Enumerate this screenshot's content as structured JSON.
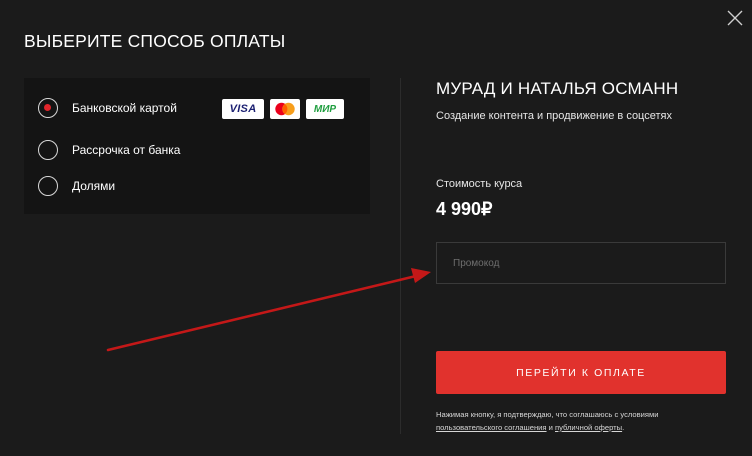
{
  "modal": {
    "title": "ВЫБЕРИТЕ СПОСОБ ОПЛАТЫ",
    "close_icon": "close-icon"
  },
  "payment_methods": [
    {
      "label": "Банковской картой",
      "selected": true
    },
    {
      "label": "Рассрочка от банка",
      "selected": false
    },
    {
      "label": "Долями",
      "selected": false
    }
  ],
  "card_logos": {
    "visa": "VISA",
    "mastercard": "mastercard-icon",
    "mir": "МИР"
  },
  "course": {
    "title": "МУРАД И НАТАЛЬЯ ОСМАНН",
    "subtitle": "Создание контента и продвижение в соцсетях",
    "price_label": "Стоимость курса",
    "price": "4 990₽"
  },
  "promo": {
    "placeholder": "Промокод",
    "value": ""
  },
  "pay_button": {
    "label": "ПЕРЕЙТИ К ОПЛАТЕ"
  },
  "agreement": {
    "text_before": "Нажимая кнопку, я подтверждаю, что соглашаюсь с условиями",
    "link_user_agreement": "пользовательского соглашения",
    "conjunction": " и ",
    "link_offer": "публичной оферты",
    "text_after": "."
  },
  "colors": {
    "background": "#1b1b1b",
    "panel": "#141414",
    "accent": "#e1322d",
    "radio_dot": "#e2252b",
    "annotation_arrow": "#c41818"
  }
}
